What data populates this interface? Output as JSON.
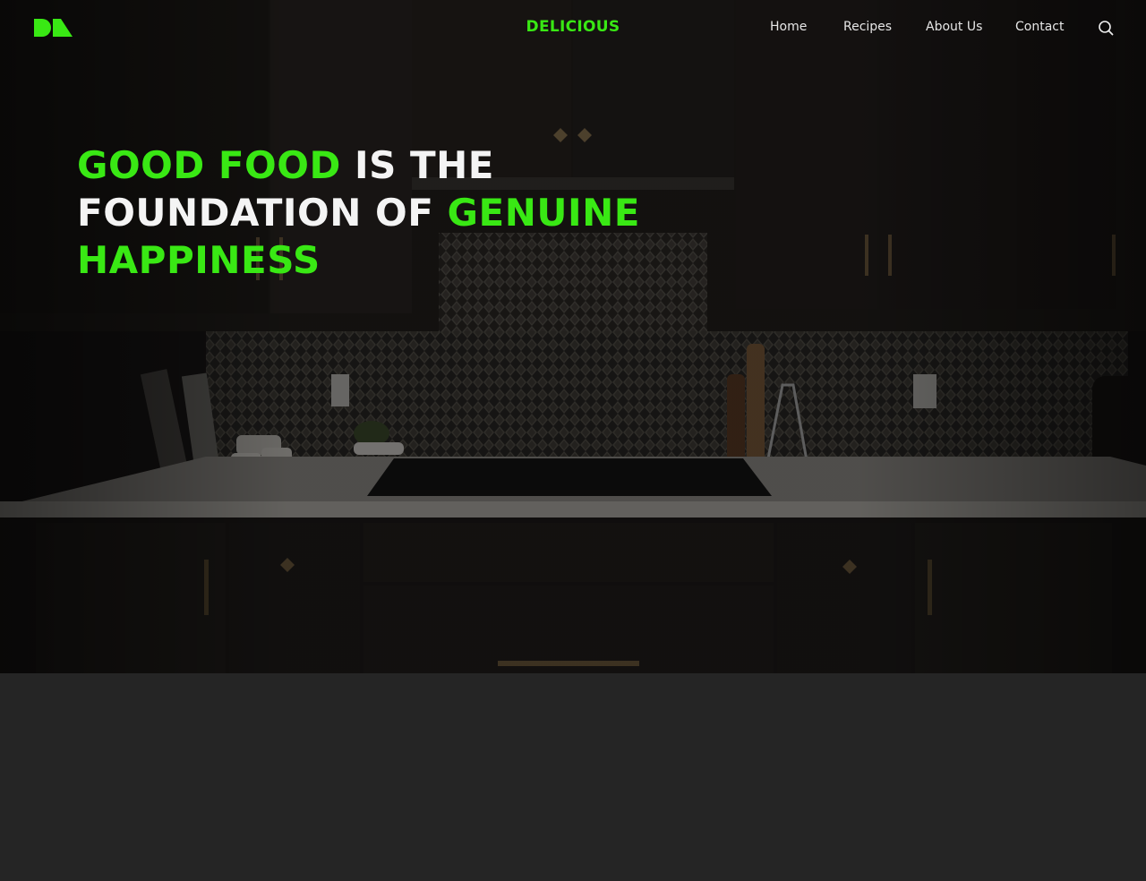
{
  "nav": {
    "brand": "DELICIOUS",
    "logo_icon": "brand-logo-icon",
    "links": [
      "Home",
      "Recipes",
      "About Us",
      "Contact"
    ],
    "search_icon": "search-icon"
  },
  "hero": {
    "headline": {
      "part1": "GOOD FOOD",
      "part2": " IS THE",
      "part3": "FOUNDATION OF ",
      "part4": "GENUINE",
      "part5": "HAPPINESS"
    },
    "background_image": "dark kitchen with cabinets, tiled backsplash and cooktop"
  },
  "colors": {
    "accent": "#39e814",
    "page_background": "#252525",
    "text": "#f4f4f4"
  }
}
